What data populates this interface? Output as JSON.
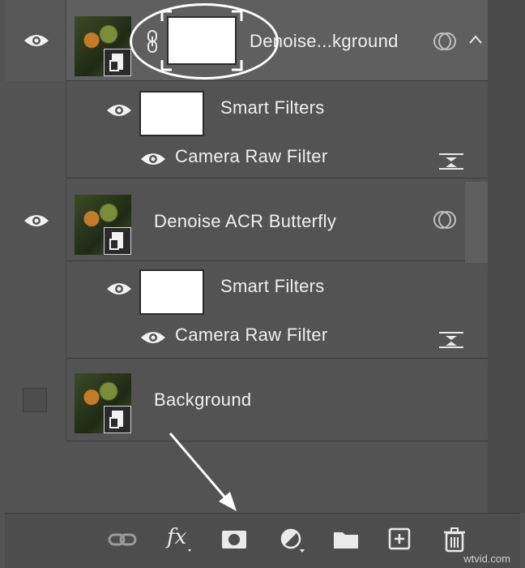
{
  "layers": [
    {
      "name": "Denoise...kground",
      "visible": true,
      "selected": true,
      "has_mask": true,
      "smart_filters": {
        "label": "Smart Filters",
        "filter": "Camera Raw Filter"
      }
    },
    {
      "name": "Denoise ACR Butterfly",
      "visible": true,
      "selected": false,
      "has_mask": false,
      "smart_filters": {
        "label": "Smart Filters",
        "filter": "Camera Raw Filter"
      }
    },
    {
      "name": "Background",
      "visible": false,
      "selected": false
    }
  ],
  "toolbar": {
    "fx_label": "fx",
    "icons": [
      "link-layers-icon",
      "fx-icon",
      "add-mask-icon",
      "adjustment-layer-icon",
      "group-folder-icon",
      "new-layer-icon",
      "trash-icon"
    ]
  },
  "watermark": "wtvid.com",
  "colors": {
    "panel": "#535353",
    "selected_row": "#6a6a6a",
    "annotation": "#ffffff"
  }
}
